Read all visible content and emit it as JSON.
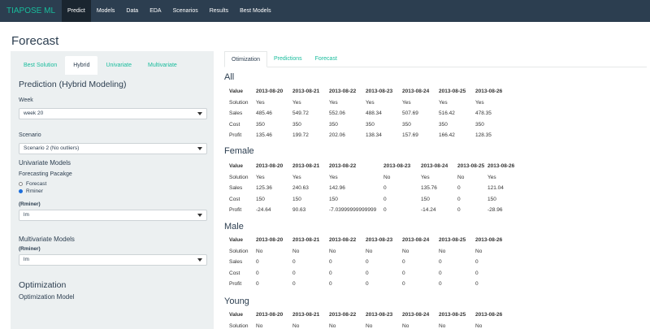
{
  "navbar": {
    "brand": "TIAPOSE ML",
    "items": [
      "Predict",
      "Models",
      "Data",
      "EDA",
      "Scenarios",
      "Results",
      "Best Models"
    ]
  },
  "page_title": "Forecast",
  "sidebar": {
    "tabs": [
      "Best Solution",
      "Hybrid",
      "Univariate",
      "Multivariate"
    ],
    "heading": "Prediction (Hybrid Modeling)",
    "week_label": "Week",
    "week_value": "week 20",
    "scenario_label": "Scenario",
    "scenario_value": "Scenario 2 (No outliers)",
    "univariate_heading": "Univariate Models",
    "package_label": "Forecasting Pacakge",
    "package_options": [
      "Forecast",
      "Rminer"
    ],
    "rminer_label": "(Rminer)",
    "univariate_model": "lm",
    "multivariate_heading": "Multivariate Models",
    "rminer_label_2": "(Rminer)",
    "multivariate_model": "lm",
    "optimization_heading": "Optimization",
    "optimization_model_label": "Optimization Model"
  },
  "main_tabs": [
    "Otimization",
    "Predictions",
    "Forecast"
  ],
  "tables": [
    {
      "title": "All",
      "columns": [
        "Value",
        "2013-08-20",
        "2013-08-21",
        "2013-08-22",
        "2013-08-23",
        "2013-08-24",
        "2013-08-25",
        "2013-08-26"
      ],
      "rows": [
        [
          "Solution",
          "Yes",
          "Yes",
          "Yes",
          "Yes",
          "Yes",
          "Yes",
          "Yes"
        ],
        [
          "Sales",
          "485.46",
          "549.72",
          "552.06",
          "488.34",
          "507.69",
          "516.42",
          "478.35"
        ],
        [
          "Cost",
          "350",
          "350",
          "350",
          "350",
          "350",
          "350",
          "350"
        ],
        [
          "Profit",
          "135.46",
          "199.72",
          "202.06",
          "138.34",
          "157.69",
          "166.42",
          "128.35"
        ]
      ]
    },
    {
      "title": "Female",
      "columns": [
        "Value",
        "2013-08-20",
        "2013-08-21",
        "2013-08-22",
        "2013-08-23",
        "2013-08-24",
        "2013-08-25",
        "2013-08-26"
      ],
      "rows": [
        [
          "Solution",
          "Yes",
          "Yes",
          "Yes",
          "No",
          "Yes",
          "No",
          "Yes"
        ],
        [
          "Sales",
          "125.36",
          "240.63",
          "142.96",
          "0",
          "135.76",
          "0",
          "121.04"
        ],
        [
          "Cost",
          "150",
          "150",
          "150",
          "0",
          "150",
          "0",
          "150"
        ],
        [
          "Profit",
          "-24.64",
          "90.63",
          "-7.03999999999999",
          "0",
          "-14.24",
          "0",
          "-28.96"
        ]
      ]
    },
    {
      "title": "Male",
      "columns": [
        "Value",
        "2013-08-20",
        "2013-08-21",
        "2013-08-22",
        "2013-08-23",
        "2013-08-24",
        "2013-08-25",
        "2013-08-26"
      ],
      "rows": [
        [
          "Solution",
          "No",
          "No",
          "No",
          "No",
          "No",
          "No",
          "No"
        ],
        [
          "Sales",
          "0",
          "0",
          "0",
          "0",
          "0",
          "0",
          "0"
        ],
        [
          "Cost",
          "0",
          "0",
          "0",
          "0",
          "0",
          "0",
          "0"
        ],
        [
          "Profit",
          "0",
          "0",
          "0",
          "0",
          "0",
          "0",
          "0"
        ]
      ]
    },
    {
      "title": "Young",
      "columns": [
        "Value",
        "2013-08-20",
        "2013-08-21",
        "2013-08-22",
        "2013-08-23",
        "2013-08-24",
        "2013-08-25",
        "2013-08-26"
      ],
      "rows": [
        [
          "Solution",
          "No",
          "No",
          "No",
          "No",
          "No",
          "No",
          "No"
        ]
      ]
    }
  ]
}
